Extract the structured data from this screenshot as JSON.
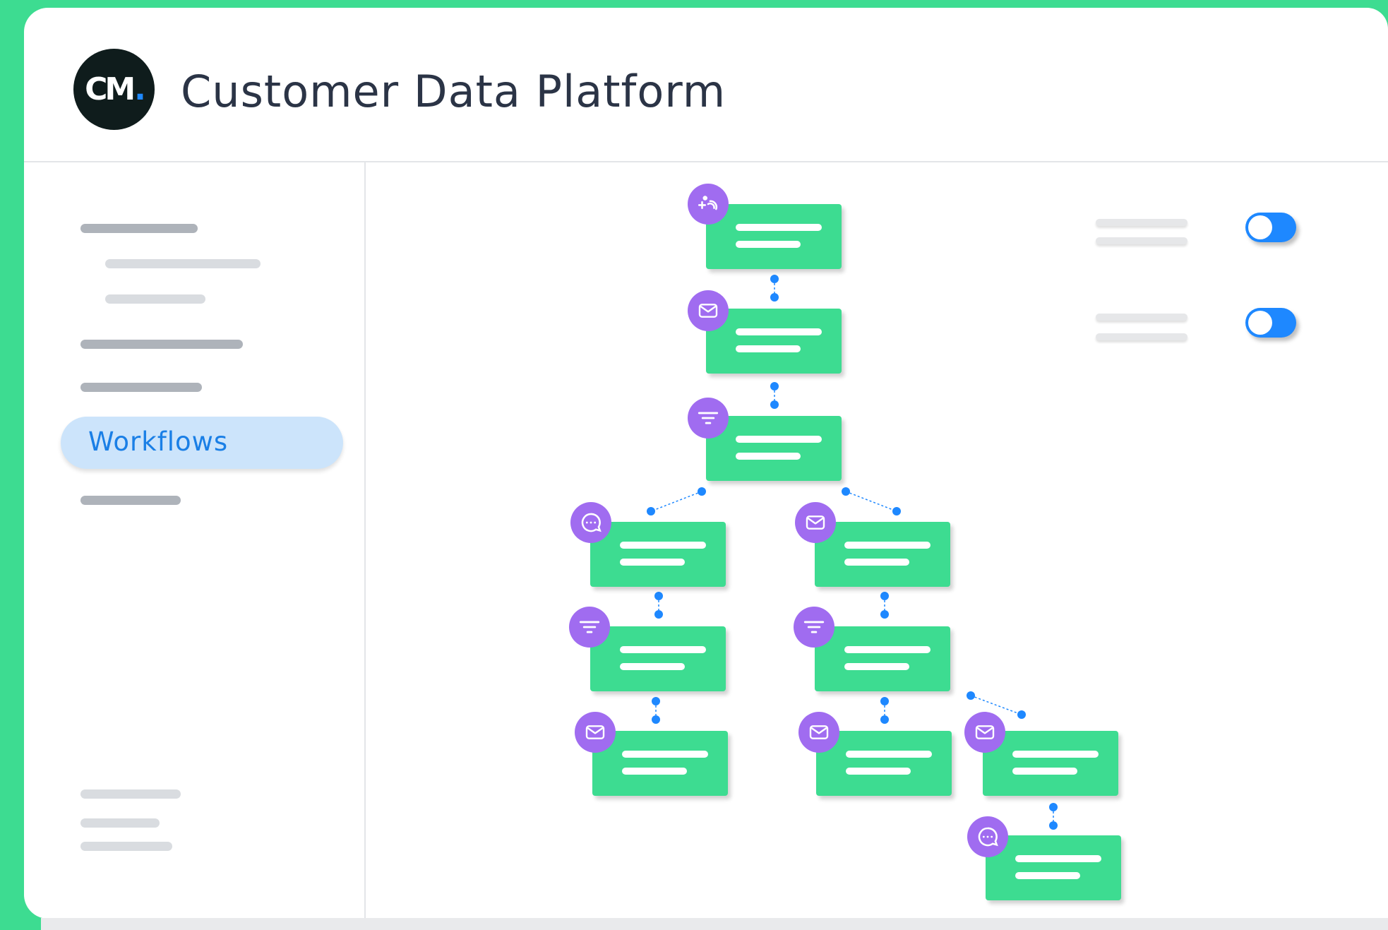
{
  "app": {
    "title": "Customer Data Platform",
    "logo_text": "CM",
    "logo_dot": "."
  },
  "sidebar": {
    "active_item": "Workflows"
  },
  "toggles": [
    {
      "state": "on"
    },
    {
      "state": "on"
    }
  ],
  "workflow": {
    "nodes": [
      {
        "id": "n1",
        "icon": "audience-icon"
      },
      {
        "id": "n2",
        "icon": "mail-icon"
      },
      {
        "id": "n3",
        "icon": "filter-icon"
      },
      {
        "id": "n4",
        "icon": "chat-icon"
      },
      {
        "id": "n5",
        "icon": "mail-icon"
      },
      {
        "id": "n6",
        "icon": "filter-icon"
      },
      {
        "id": "n7",
        "icon": "filter-icon"
      },
      {
        "id": "n8",
        "icon": "mail-icon"
      },
      {
        "id": "n9",
        "icon": "mail-icon"
      },
      {
        "id": "n10",
        "icon": "mail-icon"
      },
      {
        "id": "n11",
        "icon": "chat-icon"
      }
    ]
  },
  "colors": {
    "accent_green": "#3ddc91",
    "node_icon_purple": "#a06cf0",
    "link_blue": "#1e88ff",
    "active_nav_bg": "#cce4fb"
  }
}
